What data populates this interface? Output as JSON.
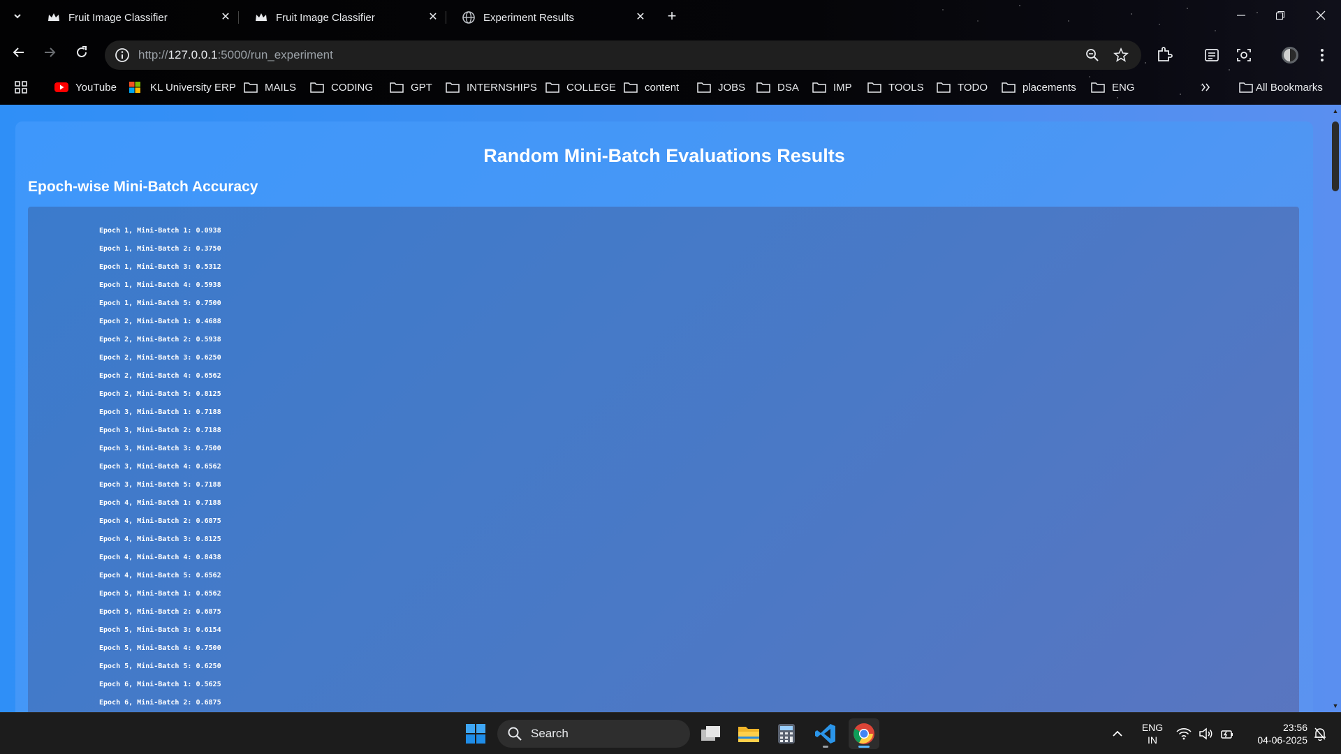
{
  "browser": {
    "tabs": [
      {
        "title": "Fruit Image Classifier",
        "icon": "crown-icon"
      },
      {
        "title": "Fruit Image Classifier",
        "icon": "crown-icon"
      },
      {
        "title": "Experiment Results",
        "icon": "globe-icon"
      }
    ],
    "url_prefix": "http://",
    "url_host": "127.0.0.1",
    "url_rest": ":5000/run_experiment",
    "bookmarks": [
      {
        "label": "YouTube",
        "icon": "youtube-icon"
      },
      {
        "label": "KL University ERP",
        "icon": "microsoft-icon"
      },
      {
        "label": "MAILS",
        "icon": "folder-icon"
      },
      {
        "label": "CODING",
        "icon": "folder-icon"
      },
      {
        "label": "GPT",
        "icon": "folder-icon"
      },
      {
        "label": "INTERNSHIPS",
        "icon": "folder-icon"
      },
      {
        "label": "COLLEGE",
        "icon": "folder-icon"
      },
      {
        "label": "content",
        "icon": "folder-icon"
      },
      {
        "label": "JOBS",
        "icon": "folder-icon"
      },
      {
        "label": "DSA",
        "icon": "folder-icon"
      },
      {
        "label": "IMP",
        "icon": "folder-icon"
      },
      {
        "label": "TOOLS",
        "icon": "folder-icon"
      },
      {
        "label": "TODO",
        "icon": "folder-icon"
      },
      {
        "label": "placements",
        "icon": "folder-icon"
      },
      {
        "label": "ENG",
        "icon": "folder-icon"
      }
    ],
    "all_bookmarks": "All Bookmarks"
  },
  "page": {
    "title": "Random Mini-Batch Evaluations Results",
    "section_title": "Epoch-wise Mini-Batch Accuracy",
    "results": [
      "Epoch 1, Mini-Batch 1: 0.0938",
      "Epoch 1, Mini-Batch 2: 0.3750",
      "Epoch 1, Mini-Batch 3: 0.5312",
      "Epoch 1, Mini-Batch 4: 0.5938",
      "Epoch 1, Mini-Batch 5: 0.7500",
      "Epoch 2, Mini-Batch 1: 0.4688",
      "Epoch 2, Mini-Batch 2: 0.5938",
      "Epoch 2, Mini-Batch 3: 0.6250",
      "Epoch 2, Mini-Batch 4: 0.6562",
      "Epoch 2, Mini-Batch 5: 0.8125",
      "Epoch 3, Mini-Batch 1: 0.7188",
      "Epoch 3, Mini-Batch 2: 0.7188",
      "Epoch 3, Mini-Batch 3: 0.7500",
      "Epoch 3, Mini-Batch 4: 0.6562",
      "Epoch 3, Mini-Batch 5: 0.7188",
      "Epoch 4, Mini-Batch 1: 0.7188",
      "Epoch 4, Mini-Batch 2: 0.6875",
      "Epoch 4, Mini-Batch 3: 0.8125",
      "Epoch 4, Mini-Batch 4: 0.8438",
      "Epoch 4, Mini-Batch 5: 0.6562",
      "Epoch 5, Mini-Batch 1: 0.6562",
      "Epoch 5, Mini-Batch 2: 0.6875",
      "Epoch 5, Mini-Batch 3: 0.6154",
      "Epoch 5, Mini-Batch 4: 0.7500",
      "Epoch 5, Mini-Batch 5: 0.6250",
      "Epoch 6, Mini-Batch 1: 0.5625",
      "Epoch 6, Mini-Batch 2: 0.6875"
    ]
  },
  "taskbar": {
    "search_placeholder": "Search",
    "lang_line1": "ENG",
    "lang_line2": "IN",
    "time": "23:56",
    "date": "04-06-2025"
  }
}
